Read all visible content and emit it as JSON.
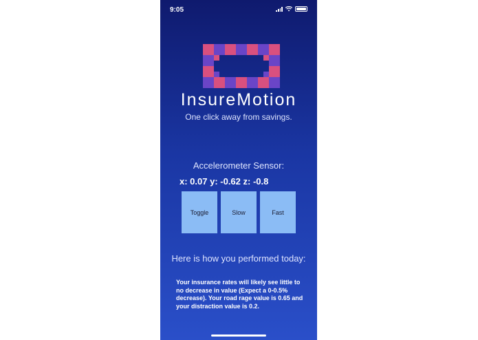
{
  "status_bar": {
    "time": "9:05",
    "icons": [
      "signal-icon",
      "wifi-icon",
      "battery-icon"
    ]
  },
  "app": {
    "name": "InsureMotion",
    "tagline": "One click away from savings."
  },
  "colors": {
    "background_top": "#0f1a6e",
    "background_bottom": "#2a4fc9",
    "logo_pink": "#d9507f",
    "logo_purple": "#6a45c7",
    "button": "#8bbcf5"
  },
  "sensor": {
    "title": "Accelerometer Sensor:",
    "values": "x: 0.07 y: -0.62 z: -0.8"
  },
  "buttons": {
    "toggle": "Toggle",
    "slow": "Slow",
    "fast": "Fast"
  },
  "performance": {
    "title": "Here is how you performed today:",
    "text": "Your insurance rates will likely see little to no decrease in value (Expect a 0-0.5% decrease). Your road rage value is 0.65 and your distraction value is 0.2."
  }
}
